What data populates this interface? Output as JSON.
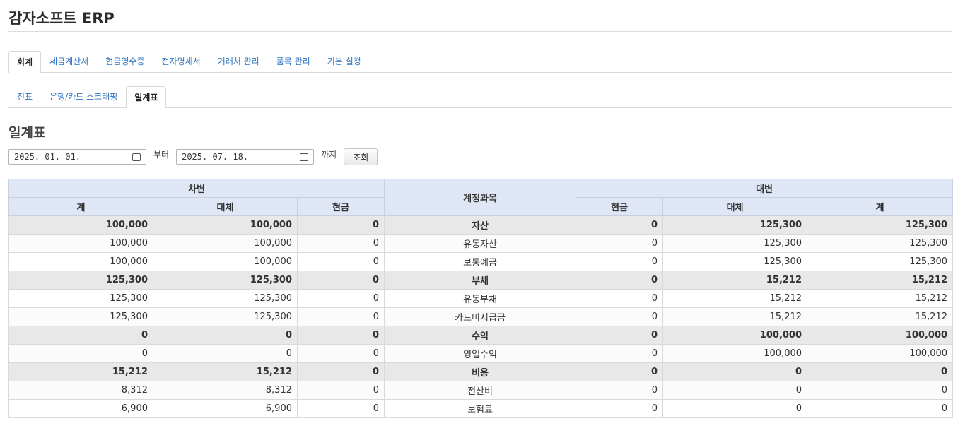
{
  "app": {
    "title": "감자소프트 ERP"
  },
  "main_tabs": [
    {
      "label": "회계",
      "active": true
    },
    {
      "label": "세금계산서",
      "active": false
    },
    {
      "label": "현금영수증",
      "active": false
    },
    {
      "label": "전자명세서",
      "active": false
    },
    {
      "label": "거래처 관리",
      "active": false
    },
    {
      "label": "품목 관리",
      "active": false
    },
    {
      "label": "기본 설정",
      "active": false
    }
  ],
  "sub_tabs": [
    {
      "label": "전표",
      "active": false
    },
    {
      "label": "은행/카드 스크래핑",
      "active": false
    },
    {
      "label": "일계표",
      "active": true
    }
  ],
  "page": {
    "title": "일계표"
  },
  "filters": {
    "start_date": "2025. 01. 01.",
    "from_label": "부터",
    "end_date": "2025. 07. 18.",
    "to_label": "까지",
    "search_button": "조회"
  },
  "table": {
    "debit_header": "차변",
    "account_header": "계정과목",
    "credit_header": "대변",
    "debit_columns": [
      "계",
      "대체",
      "현금"
    ],
    "credit_columns": [
      "현금",
      "대체",
      "계"
    ],
    "rows": [
      {
        "kind": "group",
        "debit_total": "100,000",
        "debit_transfer": "100,000",
        "debit_cash": "0",
        "account": "자산",
        "credit_cash": "0",
        "credit_transfer": "125,300",
        "credit_total": "125,300"
      },
      {
        "kind": "item",
        "debit_total": "100,000",
        "debit_transfer": "100,000",
        "debit_cash": "0",
        "account": "유동자산",
        "credit_cash": "0",
        "credit_transfer": "125,300",
        "credit_total": "125,300"
      },
      {
        "kind": "item",
        "debit_total": "100,000",
        "debit_transfer": "100,000",
        "debit_cash": "0",
        "account": "보통예금",
        "credit_cash": "0",
        "credit_transfer": "125,300",
        "credit_total": "125,300"
      },
      {
        "kind": "group",
        "debit_total": "125,300",
        "debit_transfer": "125,300",
        "debit_cash": "0",
        "account": "부채",
        "credit_cash": "0",
        "credit_transfer": "15,212",
        "credit_total": "15,212"
      },
      {
        "kind": "item",
        "debit_total": "125,300",
        "debit_transfer": "125,300",
        "debit_cash": "0",
        "account": "유동부채",
        "credit_cash": "0",
        "credit_transfer": "15,212",
        "credit_total": "15,212"
      },
      {
        "kind": "item",
        "debit_total": "125,300",
        "debit_transfer": "125,300",
        "debit_cash": "0",
        "account": "카드미지급금",
        "credit_cash": "0",
        "credit_transfer": "15,212",
        "credit_total": "15,212"
      },
      {
        "kind": "group",
        "debit_total": "0",
        "debit_transfer": "0",
        "debit_cash": "0",
        "account": "수익",
        "credit_cash": "0",
        "credit_transfer": "100,000",
        "credit_total": "100,000"
      },
      {
        "kind": "item",
        "debit_total": "0",
        "debit_transfer": "0",
        "debit_cash": "0",
        "account": "영업수익",
        "credit_cash": "0",
        "credit_transfer": "100,000",
        "credit_total": "100,000"
      },
      {
        "kind": "group",
        "debit_total": "15,212",
        "debit_transfer": "15,212",
        "debit_cash": "0",
        "account": "비용",
        "credit_cash": "0",
        "credit_transfer": "0",
        "credit_total": "0"
      },
      {
        "kind": "item",
        "debit_total": "8,312",
        "debit_transfer": "8,312",
        "debit_cash": "0",
        "account": "전산비",
        "credit_cash": "0",
        "credit_transfer": "0",
        "credit_total": "0"
      },
      {
        "kind": "item",
        "debit_total": "6,900",
        "debit_transfer": "6,900",
        "debit_cash": "0",
        "account": "보험료",
        "credit_cash": "0",
        "credit_transfer": "0",
        "credit_total": "0"
      }
    ]
  }
}
